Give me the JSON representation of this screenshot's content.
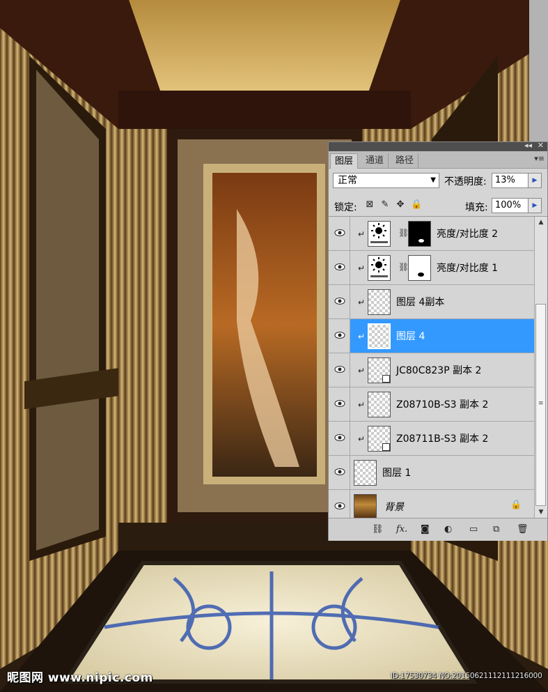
{
  "watermark": {
    "logo": "昵图网 www.nipic.com",
    "id_text": "ID:17530734 NO:20150621112111216000"
  },
  "panel": {
    "tabs": [
      {
        "label": "图层",
        "active": true
      },
      {
        "label": "通道",
        "active": false
      },
      {
        "label": "路径",
        "active": false
      }
    ],
    "blend_mode": "正常",
    "opacity_label": "不透明度:",
    "opacity_value": "13%",
    "lock_label": "锁定:",
    "fill_label": "填充:",
    "fill_value": "100%",
    "layers": [
      {
        "name": "亮度/对比度 2",
        "type": "adjustment",
        "clipped": true,
        "selected": false
      },
      {
        "name": "亮度/对比度 1",
        "type": "adjustment",
        "clipped": true,
        "selected": false
      },
      {
        "name": "图层 4副本",
        "type": "pixel",
        "clipped": true,
        "selected": false
      },
      {
        "name": "图层 4",
        "type": "pixel",
        "clipped": true,
        "selected": true
      },
      {
        "name": "JC80C823P 副本 2",
        "type": "smart",
        "clipped": true,
        "selected": false
      },
      {
        "name": "Z08710B-S3 副本 2",
        "type": "pixel",
        "clipped": true,
        "selected": false
      },
      {
        "name": "Z08711B-S3 副本 2",
        "type": "smart",
        "clipped": true,
        "selected": false
      },
      {
        "name": "图层 1",
        "type": "pixel",
        "clipped": false,
        "selected": false
      },
      {
        "name": "背景",
        "type": "background",
        "clipped": false,
        "selected": false
      }
    ],
    "icons": [
      "link-icon",
      "fx-icon",
      "mask-icon",
      "adjustment-icon",
      "folder-icon",
      "new-layer-icon",
      "trash-icon"
    ]
  },
  "colors": {
    "selection": "#3399ff",
    "panel_bg": "#d5d5d5",
    "gold": "#b08a48"
  }
}
